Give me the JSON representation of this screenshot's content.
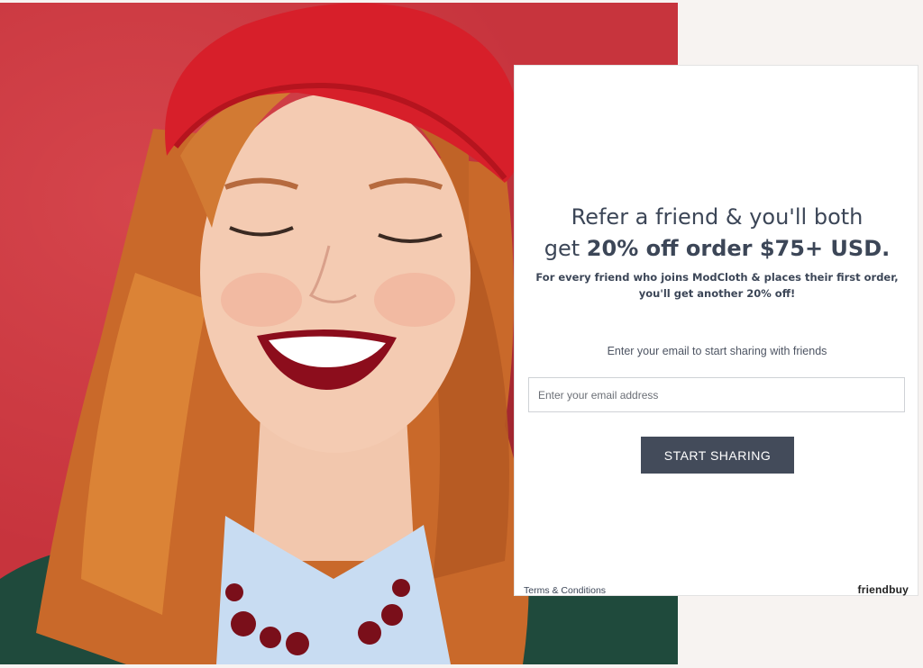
{
  "hero": {
    "image": "woman-in-red-beret-smiling-photo"
  },
  "panel": {
    "headline_line1": "Refer a friend & you'll both",
    "headline_line2_pre": "get ",
    "headline_line2_bold": "20% off order $75+ USD.",
    "subhead_line1": "For every friend who joins ModCloth & places their first order,",
    "subhead_line2": "you'll get another 20% off!",
    "prompt": "Enter your email to start sharing with friends",
    "email_placeholder": "Enter your email address",
    "cta_label": "START SHARING",
    "terms_label": "Terms & Conditions",
    "brand": "friendbuy"
  },
  "colors": {
    "background_red": "#c7343d",
    "text_dark": "#3c4657",
    "button": "#434b5a"
  }
}
